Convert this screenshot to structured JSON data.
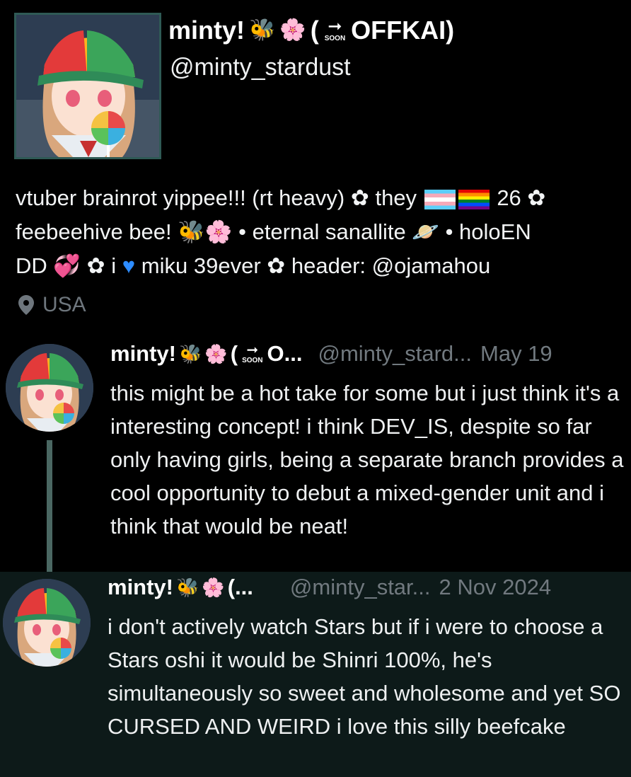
{
  "profile": {
    "display_name": "minty!",
    "name_suffix": "(",
    "soon_label": "SOON",
    "offkai": "OFFKAI)",
    "handle": "@minty_stardust",
    "bio": {
      "line1_a": "vtuber brainrot yippee!!! (rt heavy)",
      "line1_b": "they",
      "line1_c": "26",
      "line2_a": "feebeehive bee!",
      "line2_b": "• eternal sanallite",
      "line2_c": "• holoEN",
      "line3_a": "DD",
      "line3_b": "i",
      "line3_c": "miku 39ever",
      "line3_d": "header: @ojamahou"
    },
    "location": "USA"
  },
  "posts": [
    {
      "name": "minty!",
      "name_tail": "O...",
      "handle": "@minty_stard...",
      "date": "May 19",
      "text": "this might be a hot take for some but i just think it's a interesting concept! i think DEV_IS, despite so far only having girls, being a separate branch provides a cool opportunity to debut a mixed-gender unit and i think that would be neat!"
    },
    {
      "name": "minty!",
      "name_tail": "(...",
      "handle": "@minty_star...",
      "date": "2 Nov 2024",
      "text": "i don't actively watch Stars but if i were to choose a Stars oshi it would be Shinri 100%, he's simultaneously so sweet and wholesome and yet SO CURSED AND WEIRD i love this silly beefcake"
    }
  ],
  "icons": {
    "bee": "bee-icon",
    "blossom": "cherry-blossom-icon",
    "flower": "flower-icon",
    "planet": "planet-icon",
    "hearts": "hearts-icon",
    "blue_heart": "blue-heart-icon",
    "location": "location-pin-icon"
  },
  "colors": {
    "background": "#000000",
    "secondary_text": "#6e767d",
    "highlight_post_bg": "#0d1a19",
    "thread_line": "#4a6762"
  }
}
